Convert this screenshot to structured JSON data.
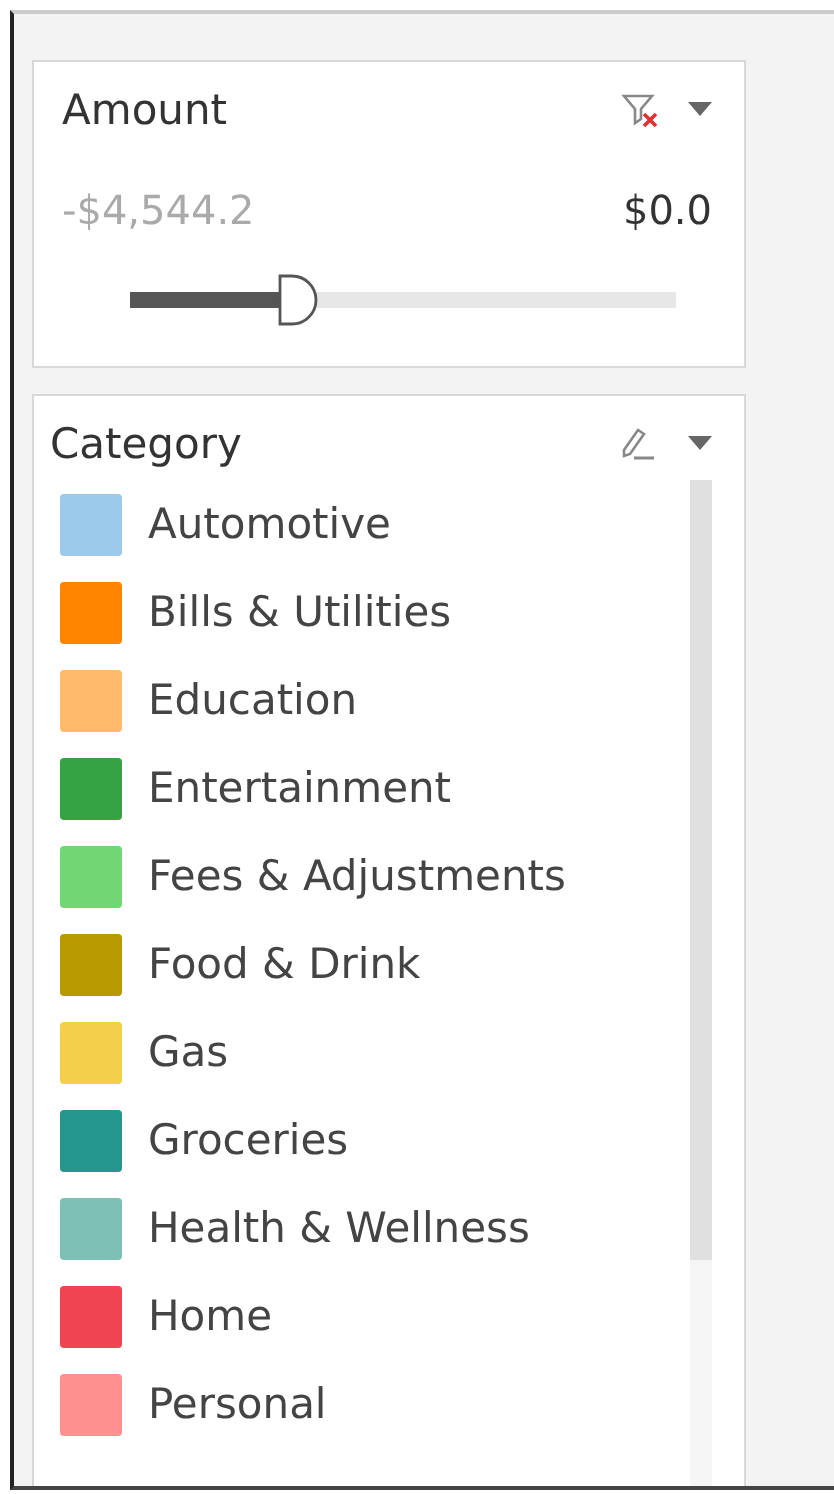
{
  "amount_filter": {
    "title": "Amount",
    "min_label": "-$4,544.2",
    "max_label": "$0.0",
    "level": 0.28
  },
  "category_legend": {
    "title": "Category",
    "items": [
      {
        "label": "Automotive",
        "color": "#9ccaea"
      },
      {
        "label": "Bills & Utilities",
        "color": "#ff8500"
      },
      {
        "label": "Education",
        "color": "#ffbb6b"
      },
      {
        "label": "Entertainment",
        "color": "#35a343"
      },
      {
        "label": "Fees & Adjustments",
        "color": "#72d672"
      },
      {
        "label": "Food & Drink",
        "color": "#b89a00"
      },
      {
        "label": "Gas",
        "color": "#f4d04a"
      },
      {
        "label": "Groceries",
        "color": "#24968e"
      },
      {
        "label": "Health & Wellness",
        "color": "#7dc0b6"
      },
      {
        "label": "Home",
        "color": "#f04450"
      },
      {
        "label": "Personal",
        "color": "#ff9090"
      }
    ]
  }
}
